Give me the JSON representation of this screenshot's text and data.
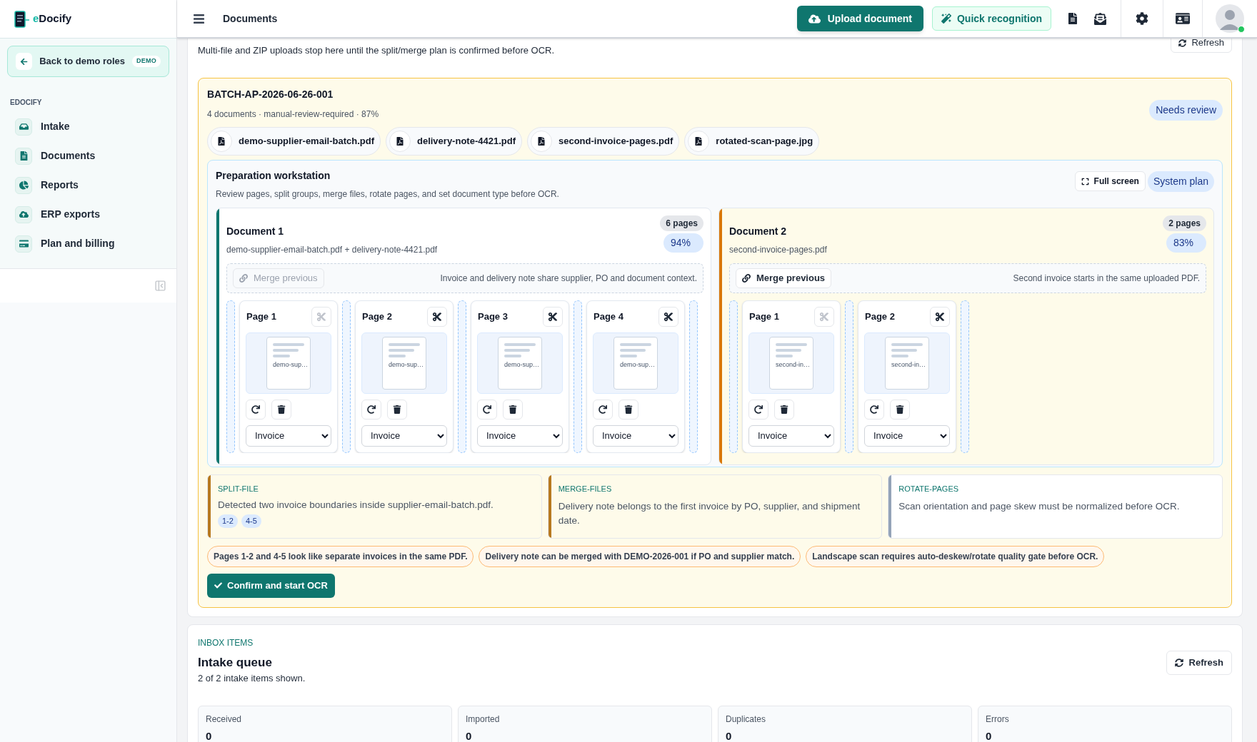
{
  "brand": {
    "accent": "e",
    "name": "Docify"
  },
  "sidebar": {
    "back": {
      "label": "Back to demo roles",
      "badge": "DEMO"
    },
    "section": "EDOCIFY",
    "items": [
      {
        "label": "Intake"
      },
      {
        "label": "Documents"
      },
      {
        "label": "Reports"
      },
      {
        "label": "ERP exports"
      },
      {
        "label": "Plan and billing"
      }
    ]
  },
  "header": {
    "title": "Documents",
    "upload": "Upload document",
    "quick": "Quick recognition"
  },
  "intro": {
    "text": "Multi-file and ZIP uploads stop here until the split/merge plan is confirmed before OCR.",
    "refresh": "Refresh"
  },
  "batch": {
    "id": "BATCH-AP-2026-06-26-001",
    "meta": "4 documents · manual-review-required · 87%",
    "status": "Needs review",
    "files": [
      "demo-supplier-email-batch.pdf",
      "delivery-note-4421.pdf",
      "second-invoice-pages.pdf",
      "rotated-scan-page.jpg"
    ]
  },
  "workstation": {
    "title": "Preparation workstation",
    "description": "Review pages, split groups, merge files, rotate pages, and set document type before OCR.",
    "full_screen": "Full screen",
    "plan": "System plan",
    "documents": [
      {
        "title": "Document 1",
        "sources": "demo-supplier-email-batch.pdf + delivery-note-4421.pdf",
        "pages_count": "6 pages",
        "confidence": "94%",
        "color": "#0f766e",
        "tinted": false,
        "merge": {
          "label": "Merge previous",
          "disabled": true
        },
        "merge_note": "Invoice and delivery note share supplier, PO and document context.",
        "pages": [
          {
            "label": "Page 1",
            "thumb": "demo-sup…",
            "split_disabled": true,
            "type": "Invoice"
          },
          {
            "label": "Page 2",
            "thumb": "demo-sup…",
            "split_disabled": false,
            "type": "Invoice"
          },
          {
            "label": "Page 3",
            "thumb": "demo-sup…",
            "split_disabled": false,
            "type": "Invoice"
          },
          {
            "label": "Page 4",
            "thumb": "demo-sup…",
            "split_disabled": false,
            "type": "Invoice"
          }
        ]
      },
      {
        "title": "Document 2",
        "sources": "second-invoice-pages.pdf",
        "pages_count": "2 pages",
        "confidence": "83%",
        "color": "#d97706",
        "tinted": true,
        "merge": {
          "label": "Merge previous",
          "disabled": false
        },
        "merge_note": "Second invoice starts in the same uploaded PDF.",
        "pages": [
          {
            "label": "Page 1",
            "thumb": "second-in…",
            "split_disabled": true,
            "type": "Invoice"
          },
          {
            "label": "Page 2",
            "thumb": "second-in…",
            "split_disabled": false,
            "type": "Invoice"
          }
        ]
      }
    ]
  },
  "plan_steps": [
    {
      "label": "SPLIT-FILE",
      "text": "Detected two invoice boundaries inside supplier-email-batch.pdf.",
      "color": "#b7791f",
      "tinted": true,
      "ranges": [
        "1-2",
        "4-5"
      ]
    },
    {
      "label": "MERGE-FILES",
      "text": "Delivery note belongs to the first invoice by PO, supplier, and shipment date.",
      "color": "#b7791f",
      "tinted": true
    },
    {
      "label": "ROTATE-PAGES",
      "text": "Scan orientation and page skew must be normalized before OCR.",
      "color": "#94a3b8",
      "tinted": false
    }
  ],
  "warnings": [
    "Pages 1-2 and 4-5 look like separate invoices in the same PDF.",
    "Delivery note can be merged with DEMO-2026-001 if PO and supplier match.",
    "Landscape scan requires auto-deskew/rotate quality gate before OCR."
  ],
  "confirm": "Confirm and start OCR",
  "inbox": {
    "eyebrow": "INBOX ITEMS",
    "title": "Intake queue",
    "subtitle": "2 of 2 intake items shown.",
    "refresh": "Refresh",
    "stats": [
      {
        "label": "Received",
        "value": "0"
      },
      {
        "label": "Imported",
        "value": "0"
      },
      {
        "label": "Duplicates",
        "value": "0"
      },
      {
        "label": "Errors",
        "value": "0"
      }
    ]
  }
}
